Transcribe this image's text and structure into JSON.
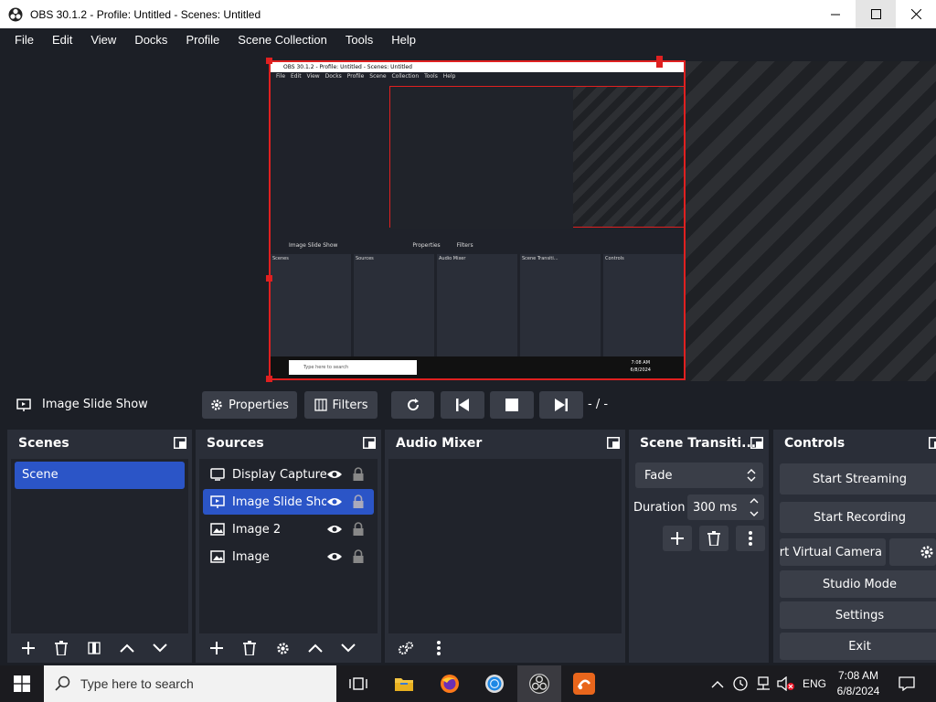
{
  "window": {
    "title": "OBS 30.1.2 - Profile: Untitled - Scenes: Untitled"
  },
  "menu": [
    "File",
    "Edit",
    "View",
    "Docks",
    "Profile",
    "Scene Collection",
    "Tools",
    "Help"
  ],
  "preview": {
    "title": "OBS 30.1.2 - Profile: Untitled - Scenes: Untitled",
    "menu": "File Edit View Docks Profile Scene Collection Tools Help",
    "bar": "Image Slide Show",
    "buttons": [
      "Properties",
      "Filters"
    ],
    "docks": [
      "Scenes",
      "Sources",
      "Audio Mixer",
      "Scene Transiti...",
      "Controls"
    ],
    "search": "Type here to search",
    "clock_time": "7:08 AM",
    "clock_date": "6/8/2024"
  },
  "controlbar": {
    "source_name": "Image Slide Show",
    "properties": "Properties",
    "filters": "Filters",
    "counter": "- / -"
  },
  "scenes": {
    "title": "Scenes",
    "items": [
      "Scene"
    ]
  },
  "sources": {
    "title": "Sources",
    "items": [
      "Display Capture",
      "Image Slide Show",
      "Image 2",
      "Image"
    ]
  },
  "audio": {
    "title": "Audio Mixer"
  },
  "transitions": {
    "title": "Scene Transiti...",
    "transition": "Fade",
    "duration_label": "Duration",
    "duration": "300 ms"
  },
  "controls": {
    "title": "Controls",
    "start_streaming": "Start Streaming",
    "start_recording": "Start Recording",
    "start_virtual_camera": "Start Virtual Camera",
    "studio_mode": "Studio Mode",
    "settings": "Settings",
    "exit": "Exit"
  },
  "taskbar": {
    "search_placeholder": "Type here to search",
    "language": "ENG",
    "time": "7:08 AM",
    "date": "6/8/2024"
  },
  "colors": {
    "accent": "#2b55c7",
    "selection_border": "#e02020",
    "dock": "#2a2e38",
    "button": "#3a3e48"
  }
}
